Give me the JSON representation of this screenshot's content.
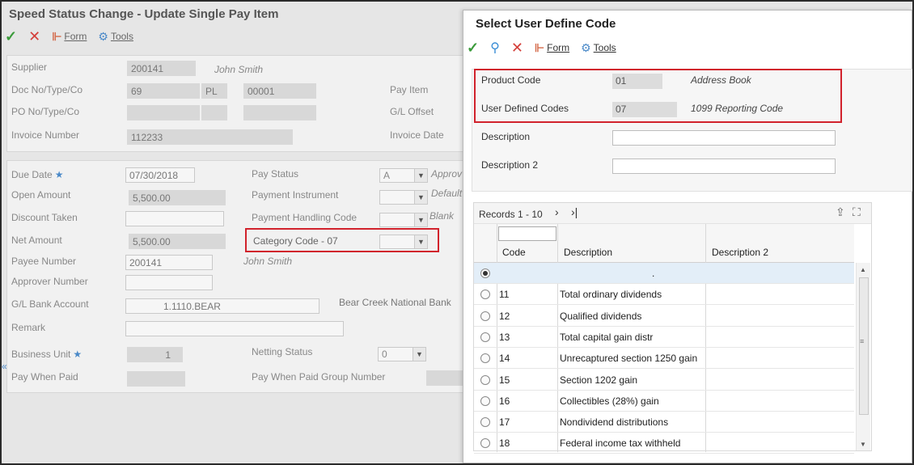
{
  "background": {
    "title": "Speed Status Change - Update Single Pay Item",
    "toolbar": {
      "form_label": "Form",
      "tools_label": "Tools"
    },
    "header": {
      "supplier_label": "Supplier",
      "supplier_value": "200141",
      "supplier_name": "John Smith",
      "doc_label": "Doc No/Type/Co",
      "doc_no": "69",
      "doc_type": "PL",
      "doc_co": "00001",
      "po_label": "PO No/Type/Co",
      "invoice_label": "Invoice Number",
      "invoice_value": "112233",
      "pay_item_label": "Pay Item",
      "gl_offset_label": "G/L Offset",
      "invoice_date_label": "Invoice Date"
    },
    "details": {
      "due_date_label": "Due Date",
      "due_date_value": "07/30/2018",
      "open_amount_label": "Open Amount",
      "open_amount_value": "5,500.00",
      "discount_label": "Discount Taken",
      "net_amount_label": "Net Amount",
      "net_amount_value": "5,500.00",
      "payee_label": "Payee Number",
      "payee_value": "200141",
      "payee_name": "John Smith",
      "approver_label": "Approver Number",
      "gl_bank_label": "G/L Bank Account",
      "gl_bank_value": "1.1110.BEAR",
      "gl_bank_name": "Bear Creek National Bank",
      "remark_label": "Remark",
      "bu_label": "Business Unit",
      "bu_value": "1",
      "pay_when_paid_label": "Pay When Paid",
      "pay_status_label": "Pay Status",
      "pay_status_value": "A",
      "pay_status_desc": "Approv",
      "pay_instrument_label": "Payment Instrument",
      "pay_instrument_desc": "Default",
      "pay_handling_label": "Payment Handling Code",
      "pay_handling_desc": "Blank",
      "category_label": "Category Code - 07",
      "netting_label": "Netting Status",
      "netting_value": "0",
      "pwp_group_label": "Pay When Paid Group Number"
    }
  },
  "popup": {
    "title": "Select User Define Code",
    "toolbar": {
      "form_label": "Form",
      "tools_label": "Tools"
    },
    "product_code_label": "Product Code",
    "product_code_value": "01",
    "product_code_desc": "Address Book",
    "udc_label": "User Defined Codes",
    "udc_value": "07",
    "udc_desc": "1099 Reporting Code",
    "description_label": "Description",
    "description2_label": "Description 2",
    "grid": {
      "records_label": "Records 1 - 10",
      "columns": [
        "Code",
        "Description",
        "Description 2"
      ],
      "rows": [
        {
          "code": "",
          "desc": "."
        },
        {
          "code": "11",
          "desc": "Total ordinary dividends"
        },
        {
          "code": "12",
          "desc": "Qualified dividends"
        },
        {
          "code": "13",
          "desc": "Total capital gain distr"
        },
        {
          "code": "14",
          "desc": "Unrecaptured section 1250 gain"
        },
        {
          "code": "15",
          "desc": "Section 1202 gain"
        },
        {
          "code": "16",
          "desc": "Collectibles (28%) gain"
        },
        {
          "code": "17",
          "desc": "Nondividend distributions"
        },
        {
          "code": "18",
          "desc": "Federal income tax withheld"
        }
      ]
    }
  }
}
